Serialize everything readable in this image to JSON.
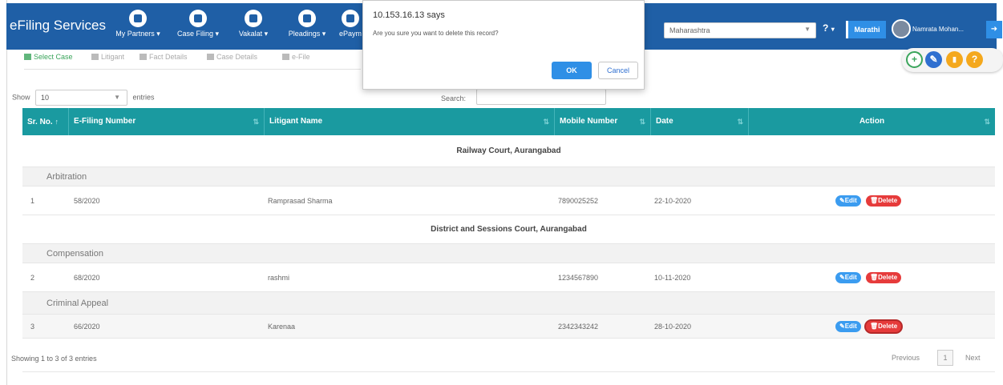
{
  "header": {
    "brand": "eFiling Services",
    "nav": [
      {
        "label": "My Partners ▾",
        "icon": "partners-icon"
      },
      {
        "label": "Case Filing ▾",
        "icon": "pen-icon"
      },
      {
        "label": "Vakalat ▾",
        "icon": "document-icon"
      },
      {
        "label": "Pleadings ▾",
        "icon": "pleadings-icon"
      },
      {
        "label": "ePaym",
        "icon": "payment-icon"
      }
    ],
    "state_select": "Maharashtra",
    "help": "?",
    "help_caret": "▾",
    "language_button": "Marathi",
    "user_name": "Namrata Mohan...",
    "logout_icon": "logout-icon"
  },
  "tabs": [
    {
      "label": "Select Case",
      "active": true,
      "icon": "list-icon"
    },
    {
      "label": "Litigant",
      "active": false,
      "icon": "user-icon"
    },
    {
      "label": "Fact Details",
      "active": false,
      "icon": "user-icon"
    },
    {
      "label": "Case Details",
      "active": false,
      "icon": "file-icon"
    },
    {
      "label": "e-File",
      "active": false,
      "icon": "check-icon"
    }
  ],
  "fabs": [
    {
      "icon": "plus-circle-icon",
      "symbol": "+",
      "color": "#ffffff",
      "border": "#3aa45b",
      "text": "#3aa45b"
    },
    {
      "icon": "edit-circle-icon",
      "symbol": "✎",
      "color": "#2f6fd0",
      "border": "#2f6fd0",
      "text": "#ffffff"
    },
    {
      "icon": "document-circle-icon",
      "symbol": "▮",
      "color": "#f4a81d",
      "border": "#f4a81d",
      "text": "#ffffff"
    },
    {
      "icon": "help-circle-icon",
      "symbol": "?",
      "color": "#f4a81d",
      "border": "#f4a81d",
      "text": "#ffffff"
    }
  ],
  "list_controls": {
    "show_label": "Show",
    "entries_value": "10",
    "entries_label": "entries",
    "search_label": "Search:",
    "search_value": ""
  },
  "table": {
    "columns": [
      "Sr. No.",
      "E-Filing Number",
      "Litigant Name",
      "Mobile Number",
      "Date",
      "Action"
    ],
    "sort_glyph": "⇅",
    "sort_glyph_active": "↑",
    "groups": [
      {
        "court": "Railway Court, Aurangabad",
        "sections": [
          {
            "case_type": "Arbitration",
            "rows": [
              {
                "sr": "1",
                "efiling": "58/2020",
                "litigant": "Ramprasad Sharma",
                "mobile": "7890025252",
                "date": "22-10-2020"
              }
            ]
          }
        ]
      },
      {
        "court": "District and Sessions Court, Aurangabad",
        "sections": [
          {
            "case_type": "Compensation",
            "rows": [
              {
                "sr": "2",
                "efiling": "68/2020",
                "litigant": "rashmi",
                "mobile": "1234567890",
                "date": "10-11-2020"
              }
            ]
          },
          {
            "case_type": "Criminal Appeal",
            "rows": [
              {
                "sr": "3",
                "efiling": "66/2020",
                "litigant": "Karenaa",
                "mobile": "2342343242",
                "date": "28-10-2020"
              }
            ]
          }
        ]
      }
    ],
    "edit_label": "Edit",
    "delete_label": "Delete"
  },
  "footer": {
    "info": "Showing 1 to 3 of 3 entries",
    "previous": "Previous",
    "page": "1",
    "next": "Next"
  },
  "dialog": {
    "title": "10.153.16.13 says",
    "message": "Are you sure you want to delete this record?",
    "ok": "OK",
    "cancel": "Cancel"
  },
  "colors": {
    "header_bg": "#1f5fa6",
    "table_header_bg": "#1a9aa0",
    "edit_button": "#3b9cf0",
    "delete_button": "#e63b3b",
    "active_tab": "#3aa45b"
  }
}
